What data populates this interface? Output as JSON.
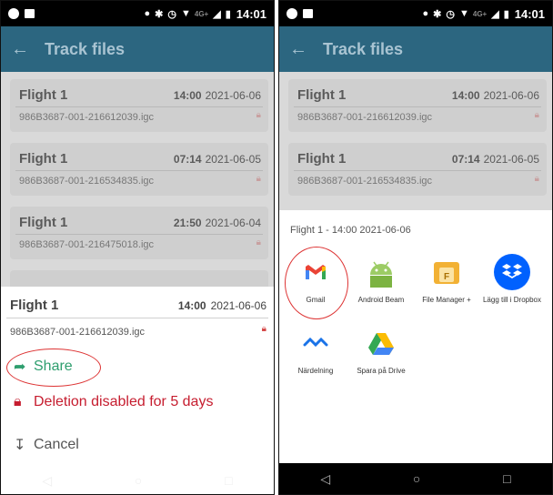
{
  "status": {
    "network": "4G+",
    "time": "14:01"
  },
  "header": {
    "title": "Track files"
  },
  "cards": [
    {
      "name": "Flight 1",
      "time": "14:00",
      "date": "2021-06-06",
      "file": "986B3687-001-216612039.igc"
    },
    {
      "name": "Flight 1",
      "time": "07:14",
      "date": "2021-06-05",
      "file": "986B3687-001-216534835.igc"
    },
    {
      "name": "Flight 1",
      "time": "21:50",
      "date": "2021-06-04",
      "file": "986B3687-001-216475018.igc"
    }
  ],
  "sheet": {
    "name": "Flight 1",
    "time": "14:00",
    "date": "2021-06-06",
    "file": "986B3687-001-216612039.igc",
    "share_label": "Share",
    "delete_label": "Deletion disabled for 5 days",
    "cancel_label": "Cancel"
  },
  "share_sheet": {
    "title": "Flight 1 - 14:00 2021-06-06",
    "apps": [
      {
        "label": "Gmail",
        "icon": "gmail-icon"
      },
      {
        "label": "Android Beam",
        "icon": "android-icon"
      },
      {
        "label": "File Manager +",
        "icon": "file-manager-icon"
      },
      {
        "label": "Lägg till i Dropbox",
        "icon": "dropbox-icon"
      },
      {
        "label": "Närdelning",
        "icon": "nearby-share-icon"
      },
      {
        "label": "Spara på Drive",
        "icon": "google-drive-icon"
      }
    ]
  },
  "colors": {
    "appbar": "#2c6680",
    "share": "#2e9e6e",
    "delete": "#c61d2f",
    "highlight": "#d33333"
  }
}
